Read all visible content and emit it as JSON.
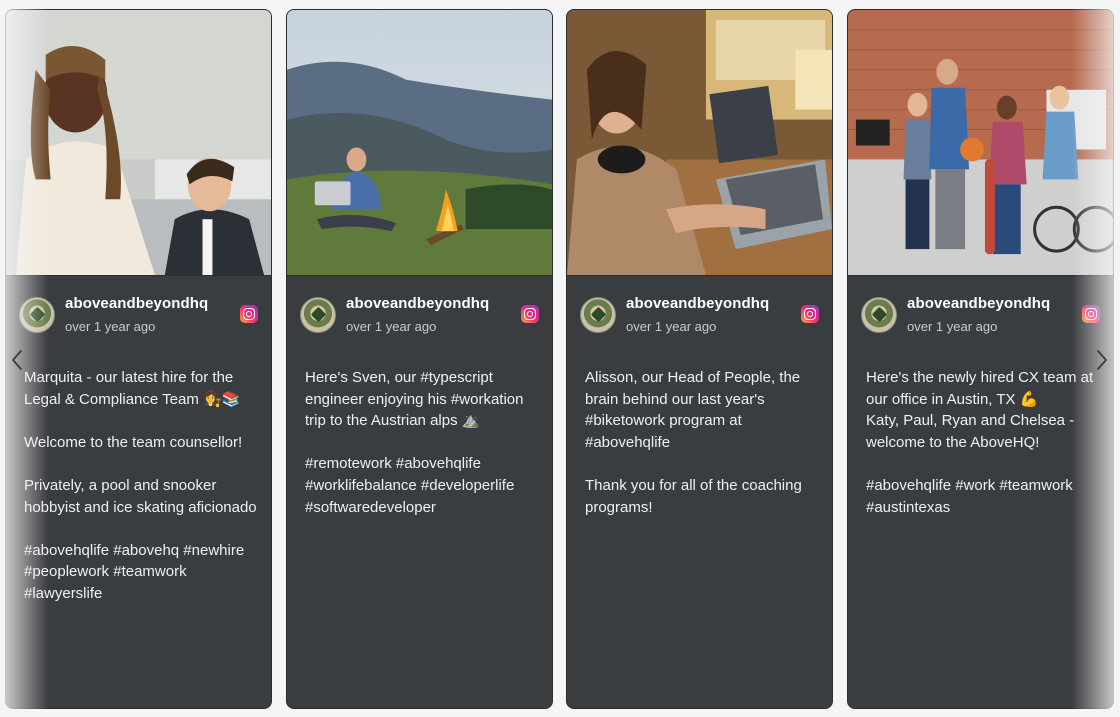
{
  "feed": {
    "posts": [
      {
        "username": "aboveandbeyondhq",
        "time": "over 1 year ago",
        "source_icon": "instagram-icon",
        "caption": "Marquita - our latest hire for the Legal & Compliance Team 👩‍⚖️📚\n\nWelcome to the team counsellor!\n\nPrivately, a pool and snooker hobbyist and ice skating aficionado\n\n#abovehqlife #abovehq #newhire #peoplework #teamwork #lawyerslife"
      },
      {
        "username": "aboveandbeyondhq",
        "time": "over 1 year ago",
        "source_icon": "instagram-icon",
        "caption": "Here's Sven, our #typescript engineer enjoying his #workation trip to the Austrian alps ⛰️\n\n#remotework #abovehqlife #worklifebalance #developerlife #softwaredeveloper"
      },
      {
        "username": "aboveandbeyondhq",
        "time": "over 1 year ago",
        "source_icon": "instagram-icon",
        "caption": "Alisson, our Head of People, the brain behind our last year's #biketowork program at #abovehqlife\n\nThank you for all of the coaching programs!"
      },
      {
        "username": "aboveandbeyondhq",
        "time": "over 1 year ago",
        "source_icon": "instagram-icon",
        "caption": "Here's the newly hired CX team at our office in Austin, TX 💪\nKaty, Paul, Ryan and Chelsea - welcome to the AboveHQ!\n\n#abovehqlife #work #teamwork #austintexas"
      }
    ]
  },
  "nav": {
    "prev_icon": "chevron-left-icon",
    "next_icon": "chevron-right-icon"
  },
  "colors": {
    "card_bg": "#3a3d40",
    "page_bg": "#f5f5f6",
    "text": "#eef0f1",
    "muted": "#c8cacc"
  }
}
